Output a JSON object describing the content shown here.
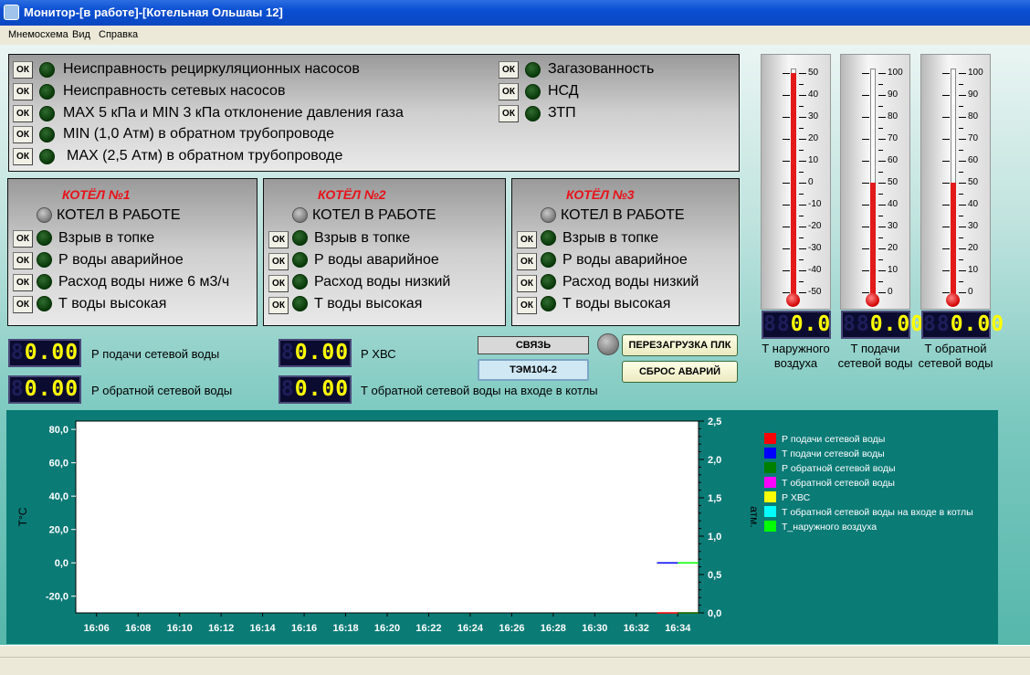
{
  "window": {
    "title": "Монитор-[в работе]-[Котельная Ольшаы 12]"
  },
  "menu": {
    "items": [
      "Мнемосхема",
      "Вид",
      "Справка"
    ]
  },
  "top_alarms": {
    "ok": "ОК",
    "left": [
      "Неисправность рециркуляционных насосов",
      "Неисправность сетевых насосов",
      "MAX 5 кПа и MIN 3 кПа  отклонение давления газа",
      "MIN (1,0 Атм) в обратном трубопроводе",
      "MAX (2,5 Атм) в обратном трубопроводе"
    ],
    "right": [
      "Загазованность",
      "НСД",
      "ЗТП"
    ]
  },
  "boilers": [
    {
      "title": "КОТЁЛ №1",
      "status": "КОТЕЛ  В  РАБОТЕ",
      "items": [
        "Взрыв в топке",
        "Р воды аварийное",
        "Расход воды ниже 6 м3/ч",
        "Т воды высокая"
      ]
    },
    {
      "title": "КОТЁЛ №2",
      "status": "КОТЕЛ  В  РАБОТЕ",
      "items": [
        "Взрыв в топке",
        "Р воды аварийное",
        "Расход воды низкий",
        "Т воды высокая"
      ]
    },
    {
      "title": "КОТЁЛ №3",
      "status": "КОТЕЛ  В  РАБОТЕ",
      "items": [
        "Взрыв в топке",
        "Р воды аварийное",
        "Расход воды низкий",
        "Т воды высокая"
      ]
    }
  ],
  "readouts": [
    {
      "value": "0.00",
      "label": "Р подачи сетевой воды"
    },
    {
      "value": "0.00",
      "label": "Р обратной сетевой воды"
    },
    {
      "value": "0.00",
      "label": "Р ХВС"
    },
    {
      "value": "0.00",
      "label": "Т обратной сетевой воды на входе в котлы"
    }
  ],
  "buttons": {
    "link": "СВЯЗЬ",
    "tem": "ТЭМ104-2",
    "reboot": "ПЕРЕЗАГРУЗКА ПЛК",
    "reset": "СБРОС АВАРИЙ"
  },
  "thermometers": [
    {
      "ticks": [
        "50",
        "40",
        "30",
        "20",
        "10",
        "0",
        "-10",
        "-20",
        "-30",
        "-40",
        "-50"
      ],
      "value": 0,
      "min": -50,
      "max": 50,
      "reading": "0.0",
      "label1": "Т наружного",
      "label2": "воздуха"
    },
    {
      "ticks": [
        "100",
        "90",
        "80",
        "70",
        "60",
        "50",
        "40",
        "30",
        "20",
        "10",
        "0"
      ],
      "value": 0,
      "min": 0,
      "max": 100,
      "reading": "0.00",
      "label1": "Т подачи",
      "label2": "сетевой воды"
    },
    {
      "ticks": [
        "100",
        "90",
        "80",
        "70",
        "60",
        "50",
        "40",
        "30",
        "20",
        "10",
        "0"
      ],
      "value": 0,
      "min": 0,
      "max": 100,
      "reading": "0.00",
      "label1": "Т обратной",
      "label2": "сетевой воды"
    }
  ],
  "colors": {
    "red_title": "#e8121a",
    "chart_bg": "#0b7b76",
    "led_off": "#0b3a0b"
  },
  "chart_data": {
    "type": "line",
    "ylabel": "T°C",
    "y2label": "атм.",
    "ylim": [
      -30,
      85
    ],
    "y2lim": [
      0,
      2.5
    ],
    "yticks": [
      "80,0",
      "60,0",
      "40,0",
      "20,0",
      "0,0",
      "-20,0"
    ],
    "y2ticks": [
      "2,5",
      "2,0",
      "1,5",
      "1,0",
      "0,5",
      "0,0"
    ],
    "xticks": [
      "16:06",
      "16:08",
      "16:10",
      "16:12",
      "16:14",
      "16:16",
      "16:18",
      "16:20",
      "16:22",
      "16:24",
      "16:26",
      "16:28",
      "16:30",
      "16:32",
      "16:34"
    ],
    "series": [
      {
        "name": "Р подачи сетевой воды",
        "color": "#ff0000",
        "x": [
          "16:33",
          "16:35"
        ],
        "y": [
          0,
          0
        ],
        "axis": "right"
      },
      {
        "name": "Т подачи сетевой воды",
        "color": "#0000ff",
        "x": [
          "16:33",
          "16:35"
        ],
        "y": [
          0,
          0
        ],
        "axis": "left"
      },
      {
        "name": "Р обратной сетевой воды",
        "color": "#008000",
        "x": [
          "16:34",
          "16:35"
        ],
        "y": [
          0,
          0
        ],
        "axis": "right"
      },
      {
        "name": "Т обратной сетевой воды",
        "color": "#ff00ff",
        "x": [],
        "y": [],
        "axis": "left"
      },
      {
        "name": "Р ХВС",
        "color": "#ffff00",
        "x": [],
        "y": [],
        "axis": "right"
      },
      {
        "name": "Т обратной сетевой воды на входе в котлы",
        "color": "#00ffff",
        "x": [],
        "y": [],
        "axis": "left"
      },
      {
        "name": "Т_наружного воздуха",
        "color": "#00ff00",
        "x": [
          "16:34",
          "16:35"
        ],
        "y": [
          0,
          0
        ],
        "axis": "left"
      }
    ]
  }
}
